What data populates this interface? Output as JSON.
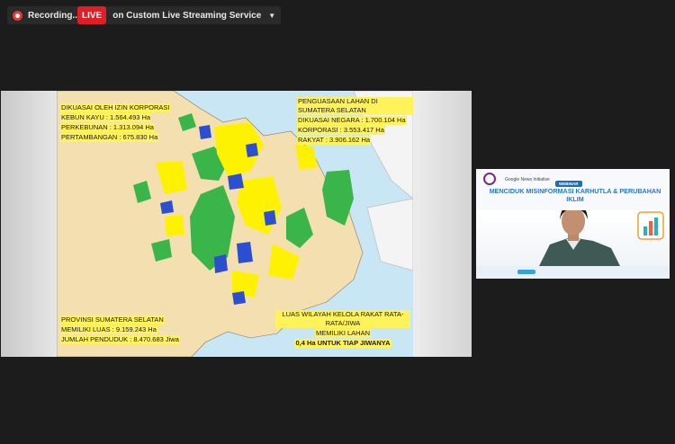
{
  "topbar": {
    "recording_label": "Recording...",
    "live_badge": "LIVE",
    "stream_label": "on Custom Live Streaming Service"
  },
  "slide": {
    "box_korporasi": {
      "line1": "DIKUASAI OLEH IZIN KORPORASI",
      "line2": "KEBUN KAYU : 1.564.493 Ha",
      "line3": "PERKEBUNAN : 1.313.094 Ha",
      "line4": "PERTAMBANGAN : 675.830 Ha"
    },
    "box_penguasaan": {
      "line1": "PENGUASAAN LAHAN DI SUMATERA SELATAN",
      "line2": "DIKUASAI NEGARA : 1.700.104 Ha",
      "line3": "KORPORASI : 3.553.417 Ha",
      "line4": "RAKYAT : 3.906.162 Ha"
    },
    "box_provinsi": {
      "line1": "PROVINSI SUMATERA SELATAN",
      "line2": "MEMILIKI LUAS : 9.159.243 Ha",
      "line3": "JUMLAH PENDUDUK : 8.470.683 Jiwa"
    },
    "box_luas": {
      "line1": "LUAS WILAYAH KELOLA RAKAT RATA-RATA/JIWA",
      "line2": "MEMILIKI LAHAN",
      "line3": "0,4 Ha UNTUK TIAP JIWANYA"
    }
  },
  "video_tile": {
    "brand": "Google News Initiative",
    "tag": "WEBINAR",
    "title": "MENCIDUK MISINFORMASI KARHUTLA & PERUBAHAN IKLIM"
  },
  "colors": {
    "live_red": "#e01e25",
    "map_land": "#f3dfb0",
    "map_green": "#39b54a",
    "map_yellow": "#fff200",
    "map_blue": "#2b4fd0",
    "label_highlight": "#fff25a",
    "sea": "#c8e6f3"
  }
}
